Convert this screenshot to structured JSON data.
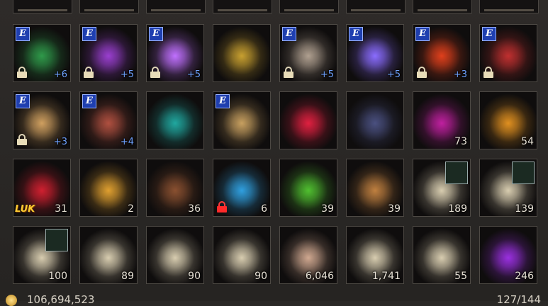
{
  "inventory": {
    "items": [
      {
        "name": "emerald-ankh-emblem",
        "icon": "ankh-emblem-icon",
        "equipped": true,
        "locked": true,
        "enhance": "+6",
        "qty": "",
        "tag": "",
        "color": "#2f9a4a"
      },
      {
        "name": "violet-ankh-emblem",
        "icon": "ankh-emblem-icon",
        "equipped": true,
        "locked": true,
        "enhance": "+5",
        "qty": "",
        "tag": "",
        "color": "#9a3fd0"
      },
      {
        "name": "crystal-orb-staff",
        "icon": "crystal-orb-icon",
        "equipped": true,
        "locked": true,
        "enhance": "+5",
        "qty": "",
        "tag": "",
        "color": "#c070ff"
      },
      {
        "name": "emerald-ring",
        "icon": "ring-icon",
        "equipped": false,
        "locked": false,
        "enhance": "",
        "qty": "",
        "tag": "",
        "color": "#c8a030"
      },
      {
        "name": "skull-ring",
        "icon": "skull-ring-icon",
        "equipped": true,
        "locked": true,
        "enhance": "+5",
        "qty": "",
        "tag": "",
        "color": "#b0a090"
      },
      {
        "name": "violet-jewel-ring",
        "icon": "jewel-ring-icon",
        "equipped": true,
        "locked": false,
        "enhance": "+5",
        "qty": "",
        "tag": "",
        "color": "#8a6cff"
      },
      {
        "name": "rune-stone-red",
        "icon": "rune-stone-icon",
        "equipped": true,
        "locked": true,
        "enhance": "+3",
        "qty": "",
        "tag": "",
        "color": "#e0401c"
      },
      {
        "name": "ruby-band",
        "icon": "ring-icon",
        "equipped": true,
        "locked": true,
        "enhance": "",
        "qty": "",
        "tag": "",
        "color": "#c03030"
      },
      {
        "name": "skull-signet-ring",
        "icon": "ring-icon",
        "equipped": true,
        "locked": true,
        "enhance": "+3",
        "qty": "",
        "tag": "",
        "color": "#d0a060"
      },
      {
        "name": "rune-tablet",
        "icon": "rune-tablet-icon",
        "equipped": true,
        "locked": false,
        "enhance": "+4",
        "qty": "",
        "tag": "",
        "color": "#b05040"
      },
      {
        "name": "teal-rune-stone",
        "icon": "rune-stone-icon",
        "equipped": false,
        "locked": false,
        "enhance": "",
        "qty": "",
        "tag": "",
        "color": "#20a8a0"
      },
      {
        "name": "golden-bracelet",
        "icon": "bracelet-icon",
        "equipped": true,
        "locked": false,
        "enhance": "",
        "qty": "",
        "tag": "",
        "color": "#c8a060"
      },
      {
        "name": "red-crystal",
        "icon": "crystal-icon",
        "equipped": false,
        "locked": false,
        "enhance": "",
        "qty": "",
        "tag": "",
        "color": "#e02040"
      },
      {
        "name": "upgrade-shield",
        "icon": "shield-arrows-icon",
        "equipped": false,
        "locked": false,
        "enhance": "",
        "qty": "",
        "tag": "",
        "color": "#4a5080"
      },
      {
        "name": "magenta-pouch",
        "icon": "pouch-icon",
        "equipped": false,
        "locked": false,
        "enhance": "",
        "qty": "73",
        "tag": "",
        "color": "#c020a0"
      },
      {
        "name": "golden-chest",
        "icon": "chest-icon",
        "equipped": false,
        "locked": false,
        "enhance": "",
        "qty": "54",
        "tag": "",
        "color": "#e09020"
      },
      {
        "name": "luk-box",
        "icon": "gift-box-icon",
        "equipped": false,
        "locked": false,
        "enhance": "",
        "qty": "31",
        "tag": "LUK",
        "color": "#d02030"
      },
      {
        "name": "gold-pouch",
        "icon": "pouch-icon",
        "equipped": false,
        "locked": false,
        "enhance": "",
        "qty": "2",
        "tag": "",
        "color": "#e0a030"
      },
      {
        "name": "sealed-chest",
        "icon": "chest-icon",
        "equipped": false,
        "locked": false,
        "enhance": "",
        "qty": "36",
        "tag": "",
        "color": "#8a5030"
      },
      {
        "name": "blue-potion",
        "icon": "potion-icon",
        "equipped": false,
        "locked": true,
        "lockRed": true,
        "enhance": "",
        "qty": "6",
        "tag": "",
        "color": "#30a0e0"
      },
      {
        "name": "green-potion",
        "icon": "potion-icon",
        "equipped": false,
        "locked": false,
        "enhance": "",
        "qty": "39",
        "tag": "",
        "color": "#50c030"
      },
      {
        "name": "food-platter",
        "icon": "food-plate-icon",
        "equipped": false,
        "locked": false,
        "enhance": "",
        "qty": "39",
        "tag": "",
        "color": "#c08040"
      },
      {
        "name": "scroll-teleport-a",
        "icon": "scroll-icon",
        "equipped": false,
        "locked": false,
        "enhance": "",
        "qty": "189",
        "tag": "",
        "color": "#d8cdb0",
        "sub": true
      },
      {
        "name": "scroll-teleport-b",
        "icon": "scroll-icon",
        "equipped": false,
        "locked": false,
        "enhance": "",
        "qty": "139",
        "tag": "",
        "color": "#d8cdb0",
        "sub": true
      },
      {
        "name": "scroll-skill",
        "icon": "scroll-icon",
        "equipped": false,
        "locked": false,
        "enhance": "",
        "qty": "100",
        "tag": "",
        "color": "#d8cdb0",
        "sub": true
      },
      {
        "name": "scroll-chalice",
        "icon": "scroll-icon",
        "equipped": false,
        "locked": false,
        "enhance": "",
        "qty": "89",
        "tag": "",
        "color": "#d8cdb0"
      },
      {
        "name": "scroll-haste",
        "icon": "scroll-icon",
        "equipped": false,
        "locked": false,
        "enhance": "",
        "qty": "90",
        "tag": "",
        "color": "#d8cdb0"
      },
      {
        "name": "scroll-revive",
        "icon": "scroll-icon",
        "equipped": false,
        "locked": false,
        "enhance": "",
        "qty": "90",
        "tag": "",
        "color": "#d8cdb0"
      },
      {
        "name": "dragon-orb",
        "icon": "orb-icon",
        "equipped": false,
        "locked": false,
        "enhance": "",
        "qty": "6,046",
        "tag": "",
        "color": "#d0a890"
      },
      {
        "name": "weapon-enchant-scroll",
        "icon": "scroll-icon",
        "equipped": false,
        "locked": false,
        "enhance": "",
        "qty": "1,741",
        "tag": "",
        "color": "#d8cdb0"
      },
      {
        "name": "armor-enchant-scroll",
        "icon": "scroll-icon",
        "equipped": false,
        "locked": false,
        "enhance": "",
        "qty": "55",
        "tag": "",
        "color": "#d8cdb0"
      },
      {
        "name": "violet-crystal-card",
        "icon": "magic-card-icon",
        "equipped": false,
        "locked": false,
        "enhance": "",
        "qty": "246",
        "tag": "",
        "color": "#9a30e0"
      }
    ]
  },
  "footer": {
    "gold": "106,694,523",
    "capacity": "127/144"
  },
  "badge_label": "E"
}
